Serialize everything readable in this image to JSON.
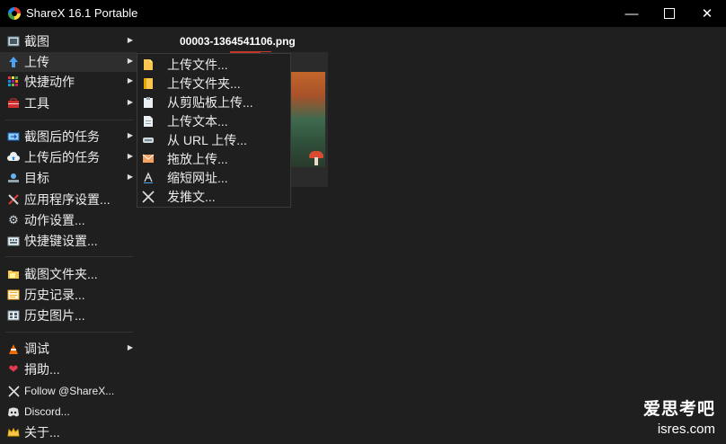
{
  "window": {
    "title": "ShareX 16.1 Portable",
    "controls": {
      "minimize": "—",
      "close": "✕"
    }
  },
  "menu": {
    "items": [
      {
        "label": "截图",
        "icon": "screenshot-icon",
        "submenu": true
      },
      {
        "label": "上传",
        "icon": "upload-arrow-icon",
        "submenu": true,
        "highlighted": true
      },
      {
        "label": "快捷动作",
        "icon": "grid-icon",
        "submenu": true
      },
      {
        "label": "工具",
        "icon": "toolbox-icon",
        "submenu": true
      },
      {
        "label": "截图后的任务",
        "icon": "after-capture-icon",
        "submenu": true
      },
      {
        "label": "上传后的任务",
        "icon": "cloud-upload-icon",
        "submenu": true
      },
      {
        "label": "目标",
        "icon": "destination-icon",
        "submenu": true
      },
      {
        "label": "应用程序设置...",
        "icon": "wrench-icon"
      },
      {
        "label": "动作设置...",
        "icon": "gear-icon"
      },
      {
        "label": "快捷键设置...",
        "icon": "keyboard-icon"
      },
      {
        "label": "截图文件夹...",
        "icon": "folder-icon"
      },
      {
        "label": "历史记录...",
        "icon": "history-icon"
      },
      {
        "label": "历史图片...",
        "icon": "image-history-icon"
      },
      {
        "label": "调试",
        "icon": "debug-cone-icon",
        "submenu": true
      },
      {
        "label": "捐助...",
        "icon": "heart-icon"
      },
      {
        "label": "Follow @ShareX...",
        "icon": "x-logo-icon"
      },
      {
        "label": "Discord...",
        "icon": "discord-icon"
      },
      {
        "label": "关于...",
        "icon": "crown-icon"
      }
    ]
  },
  "submenu": {
    "items": [
      {
        "label": "上传文件...",
        "icon": "file-upload-icon"
      },
      {
        "label": "上传文件夹...",
        "icon": "folder-upload-icon"
      },
      {
        "label": "从剪贴板上传...",
        "icon": "clipboard-icon"
      },
      {
        "label": "上传文本...",
        "icon": "text-document-icon"
      },
      {
        "label": "从 URL 上传...",
        "icon": "url-icon"
      },
      {
        "label": "拖放上传...",
        "icon": "drag-drop-icon"
      },
      {
        "label": "缩短网址...",
        "icon": "shorten-url-icon"
      },
      {
        "label": "发推文...",
        "icon": "x-logo-icon"
      }
    ]
  },
  "preview": {
    "filename": "00003-1364541106.png"
  },
  "watermark": {
    "line1": "爱思考吧",
    "line2": "isres.com"
  },
  "colors": {
    "background": "#1f1f1f",
    "titlebar": "#000000",
    "highlight": "#2e2e2e",
    "accent": "#c0392b"
  }
}
